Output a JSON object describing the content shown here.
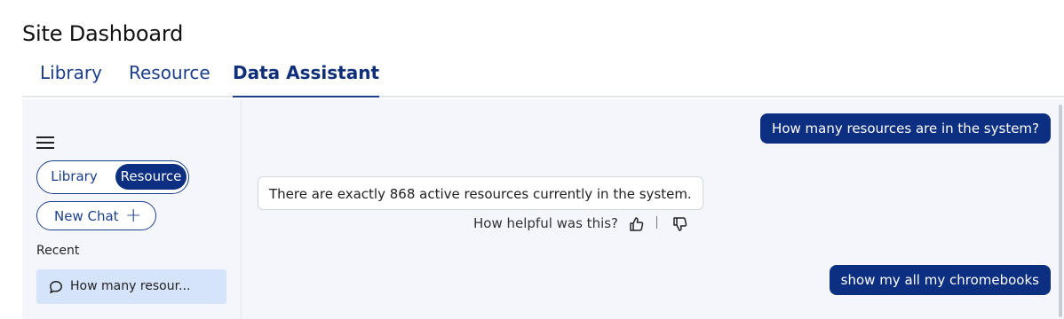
{
  "page": {
    "title": "Site Dashboard"
  },
  "tabs": [
    {
      "label": "Library"
    },
    {
      "label": "Resource"
    },
    {
      "label": "Data Assistant",
      "active": true
    }
  ],
  "sidebar": {
    "menu_icon": "hamburger-menu-icon",
    "toggle": {
      "options": [
        "Library",
        "Resource"
      ],
      "selected": "Resource"
    },
    "new_chat": {
      "label": "New Chat",
      "icon": "plus-icon"
    },
    "recent_label": "Recent",
    "recent_items": [
      {
        "label": "How many resour...",
        "icon": "chat-bubble-icon"
      }
    ]
  },
  "chat": {
    "messages": [
      {
        "role": "user",
        "text": "How many resources are in the system?"
      },
      {
        "role": "assistant",
        "text": "There are exactly 868 active resources currently in the system."
      },
      {
        "role": "user",
        "text": "show my all my chromebooks"
      }
    ],
    "feedback": {
      "question": "How helpful was this?",
      "up_icon": "thumbs-up-icon",
      "down_icon": "thumbs-down-icon"
    }
  },
  "colors": {
    "brand": "#0d2f82",
    "accent": "#1c3f8c",
    "panel": "#f4f6fb",
    "recent_highlight": "#d6e4fb"
  }
}
